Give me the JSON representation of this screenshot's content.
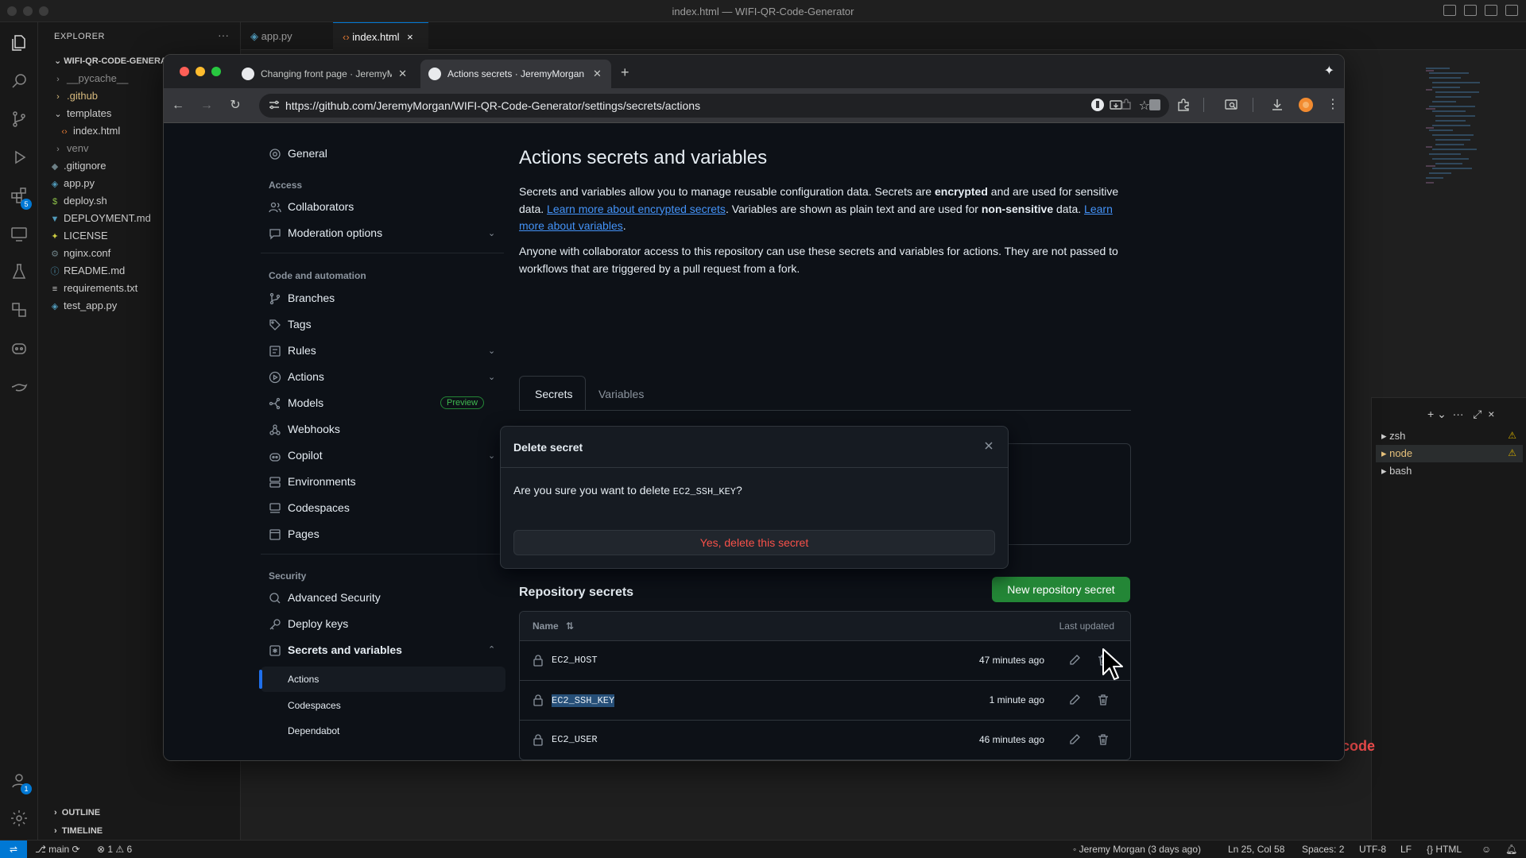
{
  "vscode": {
    "window_title": "index.html — WIFI-QR-Code-Generator",
    "explorer_header": "EXPLORER",
    "explorer_menu": "···",
    "root_folder": "WIFI-QR-CODE-GENERATOR",
    "tree": [
      {
        "label": "__pycache__",
        "type": "folder"
      },
      {
        "label": ".github",
        "type": "folder"
      },
      {
        "label": "templates",
        "type": "folder"
      },
      {
        "label": "index.html",
        "type": "file"
      },
      {
        "label": "venv",
        "type": "folder"
      },
      {
        "label": ".gitignore",
        "type": "file"
      },
      {
        "label": "app.py",
        "type": "file"
      },
      {
        "label": "deploy.sh",
        "type": "file"
      },
      {
        "label": "DEPLOYMENT.md",
        "type": "file"
      },
      {
        "label": "LICENSE",
        "type": "file"
      },
      {
        "label": "nginx.conf",
        "type": "file"
      },
      {
        "label": "README.md",
        "type": "file"
      },
      {
        "label": "requirements.txt",
        "type": "file"
      },
      {
        "label": "test_app.py",
        "type": "file"
      }
    ],
    "outline": "OUTLINE",
    "timeline": "TIMELINE",
    "extensions_badge": "5",
    "accounts_badge": "1",
    "editor_tabs": [
      {
        "label": "app.py"
      },
      {
        "label": "index.html"
      }
    ],
    "terminals": [
      "zsh",
      "node",
      "bash"
    ],
    "editor_fragment": "code",
    "status": {
      "branch": "main",
      "errors": "1",
      "warnings": "6",
      "blame": "Jeremy Morgan (3 days ago)",
      "position": "Ln 25, Col 58",
      "spaces": "Spaces: 2",
      "encoding": "UTF-8",
      "eol": "LF",
      "language": "HTML"
    }
  },
  "browser": {
    "tabs": [
      {
        "label": "Changing front page · JeremyMorgan"
      },
      {
        "label": "Actions secrets · JeremyMorgan"
      }
    ],
    "url": "https://github.com/JeremyMorgan/WIFI-QR-Code-Generator/settings/secrets/actions"
  },
  "settings_nav": {
    "general": "General",
    "access_header": "Access",
    "collaborators": "Collaborators",
    "moderation": "Moderation options",
    "code_header": "Code and automation",
    "branches": "Branches",
    "tags": "Tags",
    "rules": "Rules",
    "actions": "Actions",
    "models": "Models",
    "preview_badge": "Preview",
    "webhooks": "Webhooks",
    "copilot": "Copilot",
    "environments": "Environments",
    "codespaces": "Codespaces",
    "pages": "Pages",
    "security_header": "Security",
    "advanced_security": "Advanced Security",
    "deploy_keys": "Deploy keys",
    "secrets_variables": "Secrets and variables",
    "sub_actions": "Actions",
    "sub_codespaces": "Codespaces",
    "sub_dependabot": "Dependabot"
  },
  "main": {
    "title": "Actions secrets and variables",
    "intro_1": "Secrets and variables allow you to manage reusable configuration data. Secrets are ",
    "intro_encrypted": "encrypted",
    "intro_2": " and are used for sensitive data. ",
    "intro_link1": "Learn more about encrypted secrets",
    "intro_3": ". Variables are shown as plain text and are used for ",
    "intro_nonsensitive": "non-sensitive",
    "intro_4": " data. ",
    "intro_link2": "Learn more about variables",
    "intro_5": ".",
    "para2": "Anyone with collaborator access to this repository can use these secrets and variables for actions. They are not passed to workflows that are triggered by a pull request from a fork.",
    "tab_secrets": "Secrets",
    "tab_variables": "Variables",
    "repo_secrets_title": "Repository secrets",
    "new_secret_button": "New repository secret",
    "col_name": "Name",
    "col_updated": "Last updated",
    "secrets": [
      {
        "name": "EC2_HOST",
        "updated": "47 minutes ago"
      },
      {
        "name": "EC2_SSH_KEY",
        "updated": "1 minute ago"
      },
      {
        "name": "EC2_USER",
        "updated": "46 minutes ago"
      }
    ]
  },
  "dialog": {
    "title": "Delete secret",
    "question_prefix": "Are you sure you want to delete ",
    "secret_name": "EC2_SSH_KEY",
    "question_suffix": "?",
    "confirm_button": "Yes, delete this secret"
  },
  "colors": {
    "github_bg": "#0d1117",
    "accent_blue": "#1f6feb",
    "primary_green": "#238636",
    "danger_red": "#f85149",
    "vscode_blue": "#0078d4"
  }
}
